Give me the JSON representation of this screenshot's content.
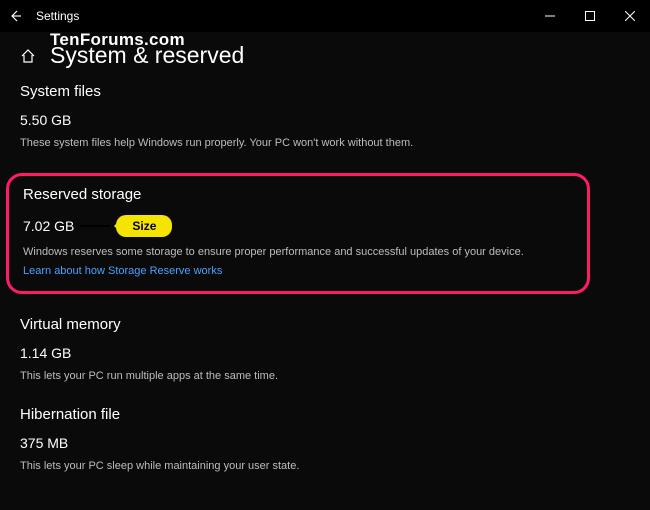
{
  "titlebar": {
    "app": "Settings"
  },
  "watermark": "TenForums.com",
  "header": {
    "title": "System & reserved"
  },
  "sections": {
    "system_files": {
      "title": "System files",
      "value": "5.50 GB",
      "desc": "These system files help Windows run properly. Your PC won't work without them."
    },
    "reserved": {
      "title": "Reserved storage",
      "value": "7.02 GB",
      "desc": "Windows reserves some storage to ensure proper performance and successful updates of your device.",
      "link": "Learn about how Storage Reserve works",
      "callout": "Size"
    },
    "virtual": {
      "title": "Virtual memory",
      "value": "1.14 GB",
      "desc": "This lets your PC run multiple apps at the same time."
    },
    "hibernation": {
      "title": "Hibernation file",
      "value": "375 MB",
      "desc": "This lets your PC sleep while maintaining your user state."
    }
  }
}
